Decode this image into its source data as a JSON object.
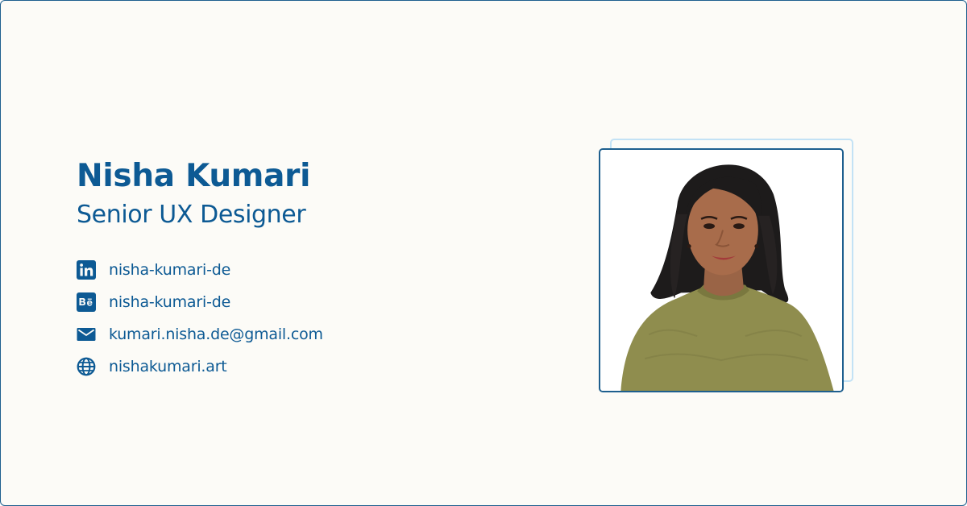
{
  "profile": {
    "name": "Nisha Kumari",
    "title": "Senior UX Designer"
  },
  "contacts": [
    {
      "icon": "linkedin-icon",
      "label": "nisha-kumari-de"
    },
    {
      "icon": "behance-icon",
      "label": "nisha-kumari-de"
    },
    {
      "icon": "mail-icon",
      "label": "kumari.nisha.de@gmail.com"
    },
    {
      "icon": "globe-icon",
      "label": "nishakumari.art"
    }
  ],
  "colors": {
    "accent": "#0d5a94",
    "background": "#fcfbf7",
    "frame_light": "#c3e2f5",
    "frame_dark": "#1e5f8e"
  }
}
